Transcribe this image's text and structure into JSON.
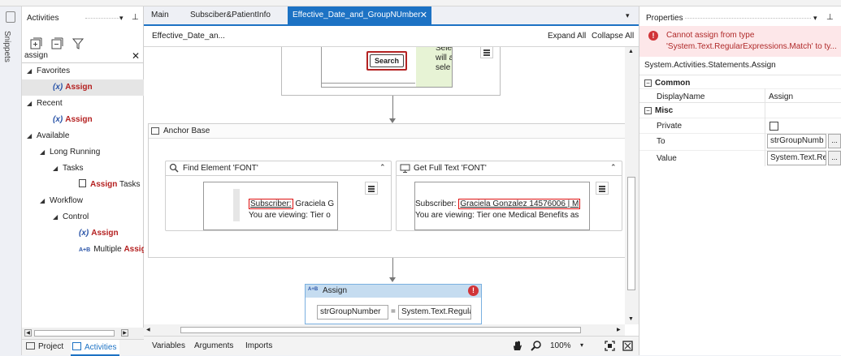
{
  "snippets": {
    "label": "Snippets"
  },
  "activities": {
    "title": "Activities",
    "search_value": "assign",
    "tree": [
      {
        "label": "Favorites",
        "kind": "group"
      },
      {
        "label": "Assign",
        "kind": "item"
      },
      {
        "label": "Recent",
        "kind": "group"
      },
      {
        "label": "Assign",
        "kind": "item"
      },
      {
        "label": "Available",
        "kind": "group"
      },
      {
        "label": "Long Running",
        "kind": "group"
      },
      {
        "label": "Tasks",
        "kind": "group"
      },
      {
        "label_kw": "Assign",
        "label_rest": " Tasks",
        "kind": "item"
      },
      {
        "label": "Workflow",
        "kind": "group"
      },
      {
        "label": "Control",
        "kind": "group"
      },
      {
        "label": "Assign",
        "kind": "item"
      },
      {
        "label_pre": "Multiple ",
        "label_kw": "Assig",
        "kind": "item"
      }
    ],
    "bottom_tabs": [
      "Project",
      "Activities"
    ]
  },
  "tabs": [
    "Main",
    "Subsciber&PatientInfo",
    "Effective_Date_and_GroupNUmber"
  ],
  "breadcrumb": "Effective_Date_an...",
  "expand_all": "Expand All",
  "collapse_all": "Collapse All",
  "top_activity": {
    "search_button": "Search",
    "side_text": [
      "Sele",
      "will a",
      "sele"
    ]
  },
  "anchor_base": {
    "title": "Anchor Base"
  },
  "find_element": {
    "title": "Find Element 'FONT'",
    "line1_boxed": "Subscriber:",
    "line1_rest": " Graciela G",
    "line2": "You are viewing: Tier o"
  },
  "get_full_text": {
    "title": "Get Full Text 'FONT'",
    "line1_pre": "Subscriber: ",
    "line1_boxed": "Graciela Gonzalez 14576006 | M",
    "line2": "You are viewing: Tier one Medical Benefits as"
  },
  "assign": {
    "title": "Assign",
    "to": "strGroupNumber",
    "equals": "=",
    "value": "System.Text.Regula"
  },
  "status": {
    "variables": "Variables",
    "arguments": "Arguments",
    "imports": "Imports",
    "zoom": "100%"
  },
  "properties": {
    "title": "Properties",
    "error_line1": "Cannot assign from type",
    "error_line2": "'System.Text.RegularExpressions.Match' to ty...",
    "class_name": "System.Activities.Statements.Assign",
    "section_common": "Common",
    "display_name_label": "DisplayName",
    "display_name_value": "Assign",
    "section_misc": "Misc",
    "private_label": "Private",
    "to_label": "To",
    "to_value": "strGroupNumb",
    "value_label": "Value",
    "value_value": "System.Text.Reg",
    "dots": "..."
  },
  "colors": {
    "accent": "#1c72c4",
    "keyword": "#b41f1f",
    "error": "#d13438",
    "assign_header": "#c5dcf0"
  }
}
